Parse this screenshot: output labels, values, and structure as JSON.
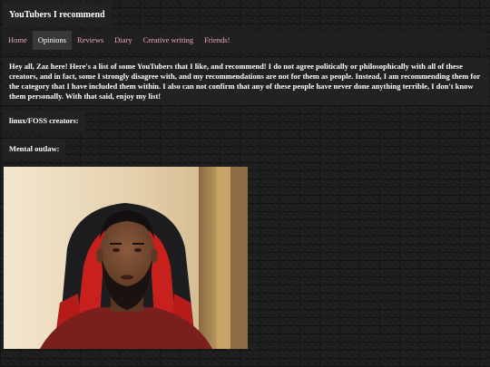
{
  "site": {
    "title": "YouTubers I recommend"
  },
  "nav": {
    "items": [
      {
        "label": "Home",
        "active": false
      },
      {
        "label": "Opinions",
        "active": true
      },
      {
        "label": "Reviews",
        "active": false
      },
      {
        "label": "Diary",
        "active": false
      },
      {
        "label": "Creative writing",
        "active": false
      },
      {
        "label": "Friends!",
        "active": false
      }
    ]
  },
  "content": {
    "intro": "Hey all, Zaz here! Here's a list of some YouTubers that I like, and recommend! I do not agree politically or philosophically with all of these creators, and in fact, some I strongly disagree with, and my recommendations are not for them as people. Instead, I am recommending them for the category that I have included them within. I also can not confirm that any of these people have never done anything terrible, I don't know them personally. With that said, enjoy my list!",
    "sections": [
      {
        "heading": "linux/FOSS creators:"
      },
      {
        "heading": "Mental outlaw:"
      }
    ]
  },
  "colors": {
    "background": "#1c1c1c",
    "panel": "#222222",
    "nav_link": "#f0a6b8",
    "nav_active_bg": "#383838",
    "text": "#ffffff"
  },
  "media": {
    "thumbnail_icon": "video-thumbnail-image"
  }
}
